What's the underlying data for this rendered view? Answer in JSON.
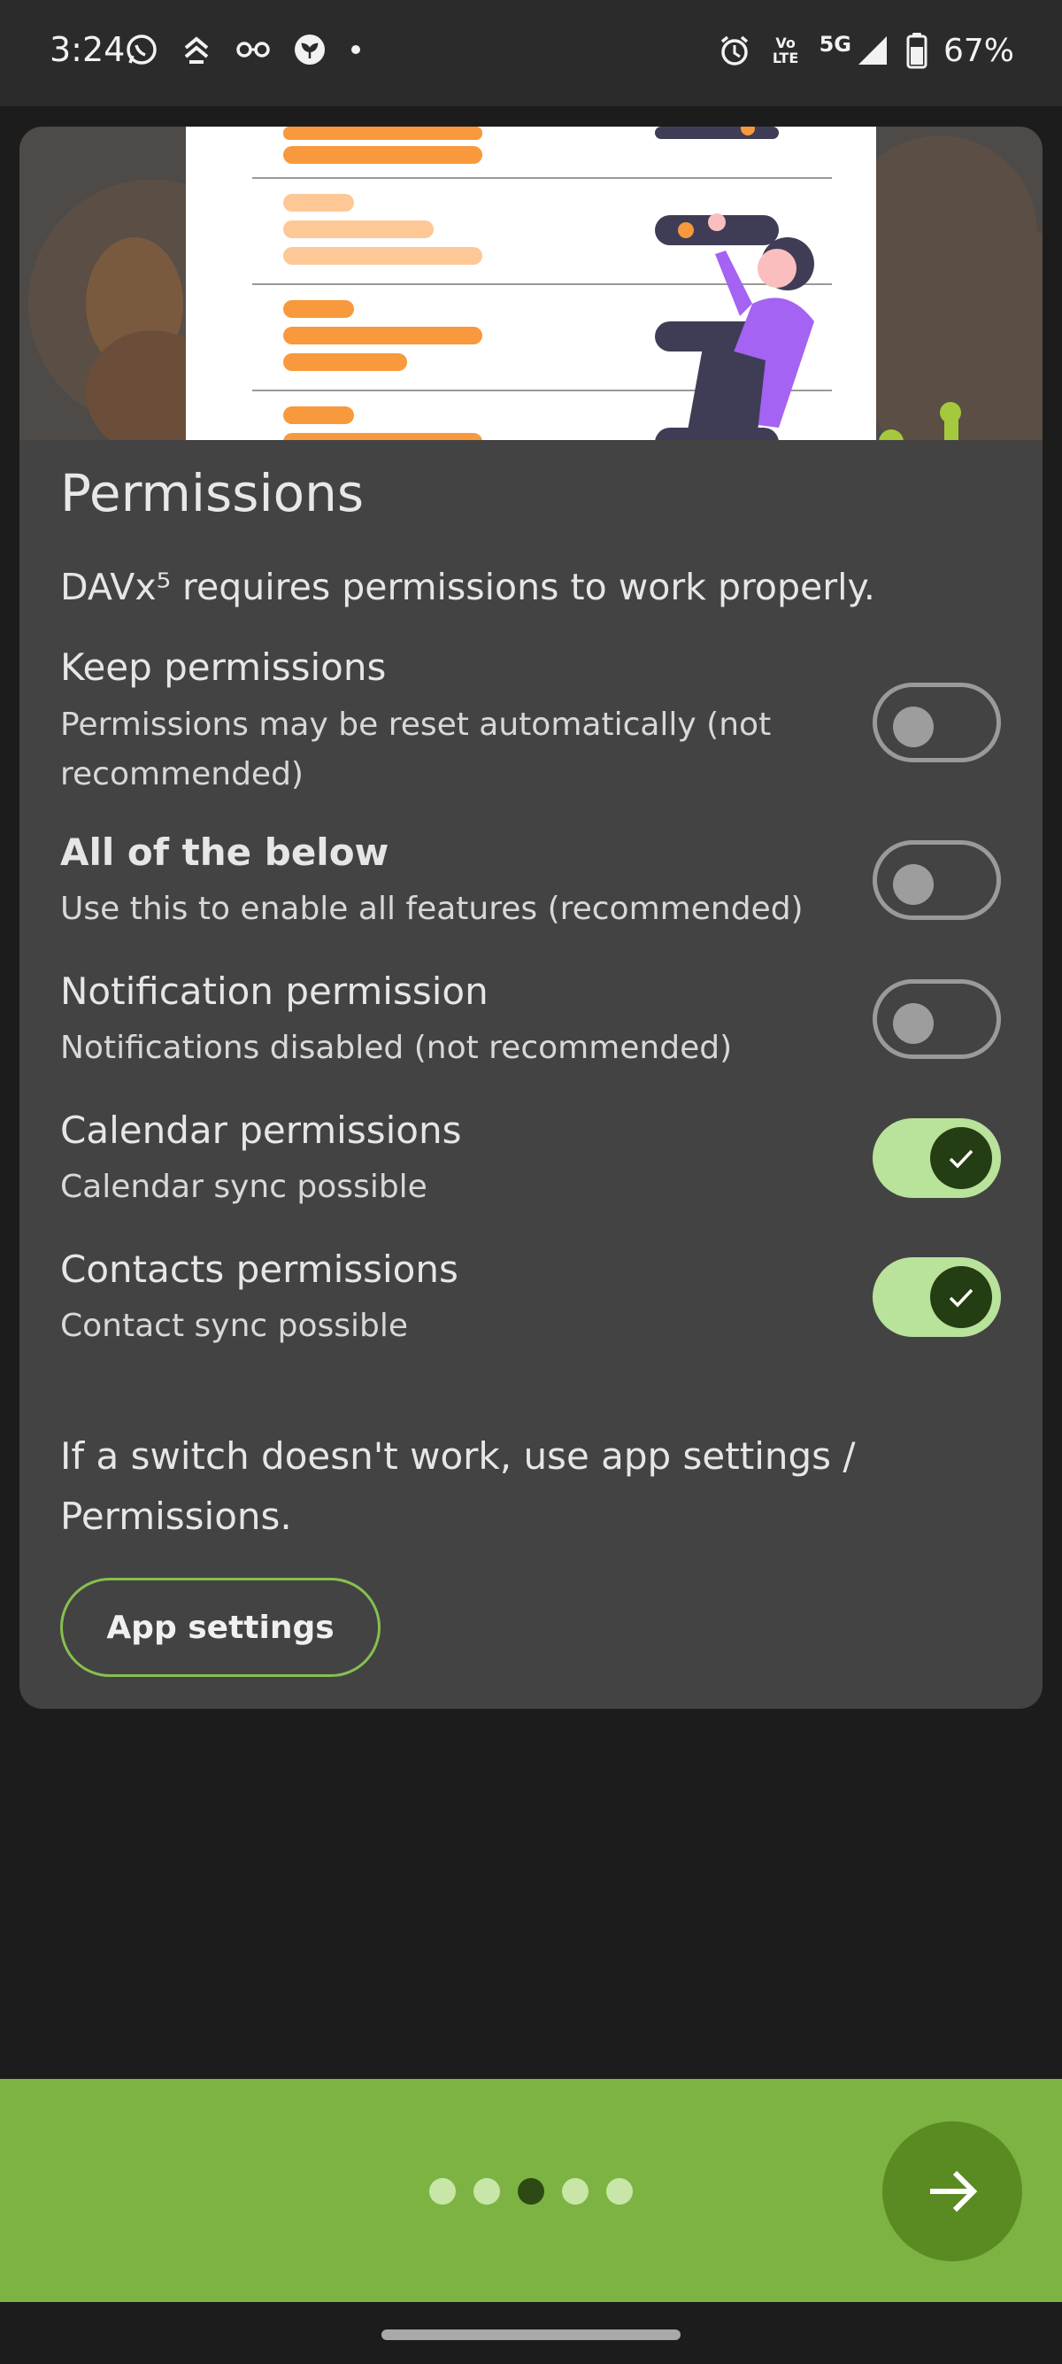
{
  "status_bar": {
    "time": "3:24",
    "battery_text": "67%",
    "network": "5G",
    "volte_label": "Vo LTE",
    "left_icons": [
      "whatsapp-icon",
      "updates-icon",
      "glasses-icon",
      "plant-icon",
      "notification-dot-icon"
    ],
    "right_icons": [
      "alarm-icon",
      "volte-icon",
      "signal-icon",
      "battery-icon"
    ]
  },
  "page": {
    "title": "Permissions",
    "intro": "DAVx⁵ requires permissions to work properly."
  },
  "permissions": [
    {
      "title": "Keep permissions",
      "subtitle": "Permissions may be reset automatically (not recommended)",
      "enabled": false
    },
    {
      "title": "All of the below",
      "subtitle": "Use this to enable all features (recommended)",
      "enabled": false
    },
    {
      "title": "Notification permission",
      "subtitle": "Notifications disabled (not recommended)",
      "enabled": false
    },
    {
      "title": "Calendar permissions",
      "subtitle": "Calendar sync possible",
      "enabled": true
    },
    {
      "title": "Contacts permissions",
      "subtitle": "Contact sync possible",
      "enabled": true
    }
  ],
  "hint": "If a switch doesn't work, use app settings / Permissions.",
  "buttons": {
    "app_settings": "App settings"
  },
  "pager": {
    "total": 5,
    "current": 3
  },
  "colors": {
    "accent": "#7cb342",
    "accent_dark": "#5a8a22",
    "card": "#434343",
    "background": "#1c1c1c",
    "switch_on_track": "#b9e29a",
    "switch_on_thumb": "#243d12"
  }
}
